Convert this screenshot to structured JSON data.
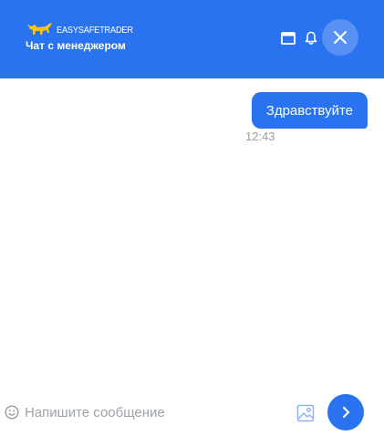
{
  "header": {
    "brand_name": "EASYSAFETRADER",
    "title": "Чат с менеджером",
    "icons": {
      "logo": "bull-logo-icon",
      "window": "window-icon",
      "bell": "bell-icon",
      "close": "close-icon"
    }
  },
  "messages": [
    {
      "text": "Здравствуйте",
      "time": "12:43",
      "outgoing": true
    }
  ],
  "composer": {
    "placeholder": "Напишите сообщение",
    "value": "",
    "icons": {
      "emoji": "smile-icon",
      "image": "image-icon",
      "send": "chevron-right-icon"
    }
  },
  "colors": {
    "accent": "#2a73f0",
    "logo": "#f5c518",
    "muted": "#9aa0a6"
  }
}
